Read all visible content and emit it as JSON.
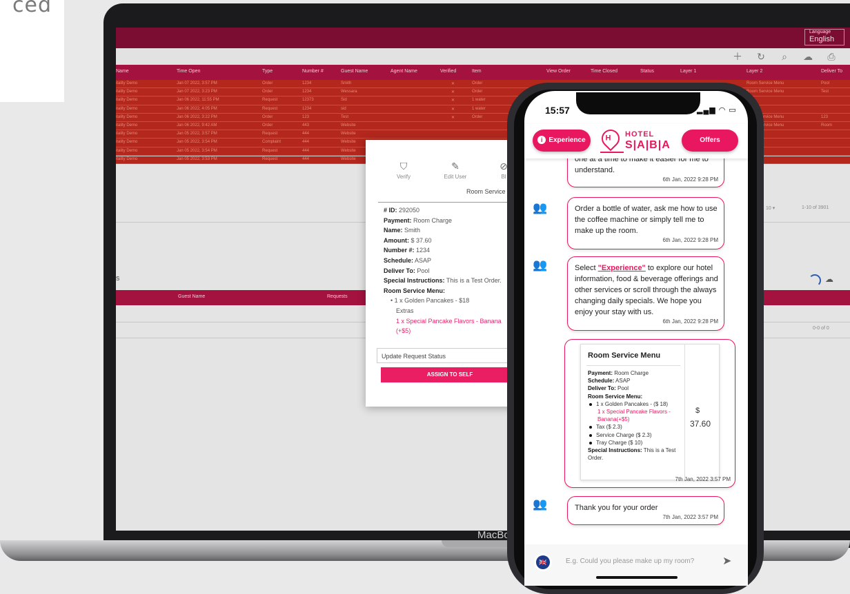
{
  "corner": {
    "text": "ced"
  },
  "laptop": {
    "brand": "MacBo"
  },
  "dashboard": {
    "language_caption": "Language",
    "language_value": "English",
    "toolbar_icons": [
      "plus-icon",
      "refresh-icon",
      "search-icon",
      "cloud-download-icon",
      "print-icon"
    ],
    "columns": [
      "Name",
      "Time Open",
      "Type",
      "Number #",
      "Guest Name",
      "Agent Name",
      "Verified",
      "Item",
      "View Order",
      "Time Closed",
      "Status",
      "Layer 1",
      "Layer 2",
      "Deliver To"
    ],
    "rows": [
      {
        "name": "itality Demo",
        "time": "Jan 07 2022, 3:57 PM",
        "type": "Order",
        "number": "1234",
        "guest": "Smith",
        "verified": "✕",
        "item": "Order",
        "layer2": "Room Service Menu",
        "deliver": "Pool"
      },
      {
        "name": "itality Demo",
        "time": "Jan 07 2022, 3:23 PM",
        "type": "Order",
        "number": "1234",
        "guest": "Wessara",
        "verified": "✕",
        "item": "Order",
        "layer2": "Room Service Menu",
        "deliver": "Test"
      },
      {
        "name": "itality Demo",
        "time": "Jan 06 2022, 11:55 PM",
        "type": "Request",
        "number": "12373",
        "guest": "Sid",
        "verified": "✕",
        "item": "1 water",
        "layer2": "",
        "deliver": ""
      },
      {
        "name": "itality Demo",
        "time": "Jan 06 2022, 4:05 PM",
        "type": "Request",
        "number": "1234",
        "guest": "sid",
        "verified": "✕",
        "item": "1 water",
        "layer2": "",
        "deliver": ""
      },
      {
        "name": "itality Demo",
        "time": "Jan 06 2022, 3:22 PM",
        "type": "Order",
        "number": "123",
        "guest": "Test",
        "verified": "✕",
        "item": "Order",
        "layer2": "Room Service Menu",
        "deliver": "123"
      },
      {
        "name": "itality Demo",
        "time": "Jan 06 2022, 9:42 AM",
        "type": "Order",
        "number": "443",
        "guest": "Website",
        "verified": "",
        "item": "",
        "layer2": "Room Service Menu",
        "deliver": "Room"
      },
      {
        "name": "itality Demo",
        "time": "Jan 05 2022, 3:57 PM",
        "type": "Request",
        "number": "444",
        "guest": "Website",
        "verified": "",
        "item": "",
        "layer2": "",
        "deliver": ""
      },
      {
        "name": "itality Demo",
        "time": "Jan 05 2022, 3:54 PM",
        "type": "Complaint",
        "number": "444",
        "guest": "Website",
        "verified": "",
        "item": "",
        "layer2": "",
        "deliver": ""
      },
      {
        "name": "itality Demo",
        "time": "Jan 05 2022, 3:54 PM",
        "type": "Request",
        "number": "444",
        "guest": "Website",
        "verified": "",
        "item": "",
        "layer2": "",
        "deliver": ""
      },
      {
        "name": "itality Demo",
        "time": "Jan 05 2022, 3:53 PM",
        "type": "Request",
        "number": "444",
        "guest": "Website",
        "verified": "",
        "item": "",
        "layer2": "",
        "deliver": ""
      }
    ],
    "rows_per_page": "10 ▾",
    "pager": "1-10 of 3901",
    "section2_title": "s",
    "columns2": [
      "Guest Name",
      "Requests"
    ],
    "pager2": "0-0 of 0"
  },
  "modal": {
    "actions": [
      {
        "label": "Verify",
        "icon": "shield-check-icon"
      },
      {
        "label": "Edit User",
        "icon": "pencil-icon"
      },
      {
        "label": "Bl",
        "icon": "block-icon"
      }
    ],
    "title": "Room Service",
    "id_label": "# ID:",
    "id_value": "292050",
    "payment_label": "Payment:",
    "payment_value": "Room Charge",
    "name_label": "Name:",
    "name_value": "Smith",
    "amount_label": "Amount:",
    "amount_value": "$ 37.60",
    "number_label": "Number #:",
    "number_value": "1234",
    "schedule_label": "Schedule:",
    "schedule_value": "ASAP",
    "deliver_label": "Deliver To:",
    "deliver_value": "Pool",
    "special_label": "Special Instructions:",
    "special_value": "This is a Test Order.",
    "menu_label": "Room Service Menu:",
    "item": "1 x Golden Pancakes - $18",
    "extras_label": "Extras",
    "extra_item": "1 x Special Pancake Flavors - Banana",
    "extra_price": "(+$5)",
    "status_placeholder": "Update Request Status",
    "assign_button": "ASSIGN TO SELF"
  },
  "phone": {
    "time": "15:57",
    "status_icons": "📶 ᯤ ▭",
    "experience_button": "Experience",
    "offers_button": "Offers",
    "logo_top": "HOTEL",
    "logo_bottom": "S|A|B|A",
    "logo_mark": "H",
    "msg1_text": "one at a time to make it easier for me to understand.",
    "msg1_time": "6th Jan, 2022 9:28 PM",
    "msg2_text": "Order a bottle of water, ask me how to use the coffee machine or simply tell me to make up the room.",
    "msg2_time": "6th Jan, 2022 9:28 PM",
    "msg3_pre": "Select ",
    "msg3_link": "\"Experience\"",
    "msg3_post": " to explore our hotel information, food & beverage offerings and other services or scroll through the always changing daily specials. We hope you enjoy your stay with us.",
    "msg3_time": "6th Jan, 2022 9:28 PM",
    "card_title": "Room Service Menu",
    "card_payment_label": "Payment:",
    "card_payment_value": "Room Charge",
    "card_schedule_label": "Schedule:",
    "card_schedule_value": "ASAP",
    "card_deliver_label": "Deliver To:",
    "card_deliver_value": "Pool",
    "card_menu_label": "Room Service Menu:",
    "card_item1": "1 x Golden Pancakes - ($ 18)",
    "card_item1_extra": "1 x Special Pancake Flavors - Banana(+$5)",
    "card_tax": "Tax ($ 2.3)",
    "card_service": "Service Charge ($ 2.3)",
    "card_tray": "Tray Charge ($ 10)",
    "card_special_label": "Special Instructions:",
    "card_special_value": "This is a Test Order.",
    "card_currency": "$",
    "card_amount": "37.60",
    "card_time": "7th Jan, 2022 3:57 PM",
    "msg4_text": "Thank you for your order",
    "msg4_time": "7th Jan, 2022 3:57 PM",
    "input_placeholder": "E.g. Could you please make up my room?",
    "flag": "🇬🇧"
  }
}
